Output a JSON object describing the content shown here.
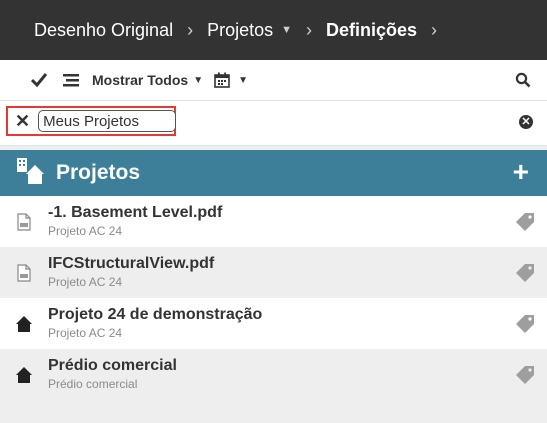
{
  "breadcrumb": {
    "items": [
      {
        "label": "Desenho Original"
      },
      {
        "label": "Projetos"
      },
      {
        "label": "Definições"
      }
    ]
  },
  "toolbar": {
    "filter_label": "Mostrar Todos"
  },
  "filter": {
    "value": "Meus Projetos"
  },
  "section": {
    "title": "Projetos"
  },
  "projects": [
    {
      "name": "-1. Basement Level.pdf",
      "subtitle": "Projeto AC 24",
      "icon": "pdf-icon"
    },
    {
      "name": "IFCStructuralView.pdf",
      "subtitle": "Projeto AC 24",
      "icon": "pdf-icon"
    },
    {
      "name": "Projeto 24 de demonstração",
      "subtitle": "Projeto AC 24",
      "icon": "house-icon"
    },
    {
      "name": "Prédio comercial",
      "subtitle": "Prédio comercial",
      "icon": "house-icon"
    }
  ],
  "colors": {
    "breadcrumb_bg": "#333333",
    "section_header": "#3d7f99",
    "highlight_border": "#e53935"
  }
}
